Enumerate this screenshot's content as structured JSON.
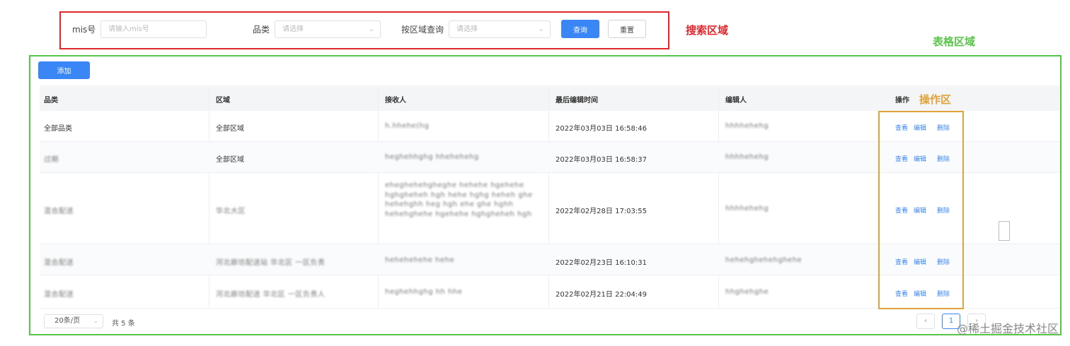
{
  "search": {
    "mis_label": "mis号",
    "mis_placeholder": "请输入mis号",
    "category_label": "品类",
    "category_placeholder": "请选择",
    "region_label": "按区域查询",
    "region_placeholder": "请选择",
    "query_button": "查询",
    "reset_button": "重置"
  },
  "annotations": {
    "search_area": "搜索区域",
    "table_area": "表格区域",
    "operation_area": "操作区"
  },
  "colors": {
    "primary": "#3a86f7",
    "search_box": "#e0262b",
    "table_box": "#56c548",
    "op_box": "#e0a33a"
  },
  "table": {
    "add_button": "添加",
    "headers": [
      "品类",
      "区域",
      "接收人",
      "最后编辑时间",
      "编辑人",
      "操作"
    ],
    "rows": [
      {
        "category": "全部品类",
        "region": "全部区域",
        "receiver": "h.hhehe(hg",
        "time": "2022年03月03日 16:58:46",
        "editor": "hhhhehehg"
      },
      {
        "category": "过期",
        "region": "全部区域",
        "receiver": "heghehhghg hhehehehg",
        "time": "2022年03月03日 16:58:37",
        "editor": "hhhhehehg"
      },
      {
        "category": "混合配送",
        "region": "华北大区",
        "receiver": "eheghehehgheghe hehehe hgehehe hghgheheh hgh hehe hghg heheh ghe hehehghh heg hgh ehe ghe hghh hehehghehe hgehehe hghgheheh hgh",
        "time": "2022年02月28日 17:03:55",
        "editor": "hhhhehehg"
      },
      {
        "category": "混合配送",
        "region": "河北廊坊配送站 华北区 一区负责",
        "receiver": "hehehehehe hehe",
        "time": "2022年02月23日 16:10:31",
        "editor": "hehehghehehghehe"
      },
      {
        "category": "混合配送",
        "region": "河北廊坊配送 华北区 一区负责人",
        "receiver": "heghehhghg hh hhe",
        "time": "2022年02月21日 22:04:49",
        "editor": "hhghehghe"
      }
    ],
    "actions": {
      "view": "查看",
      "edit": "编辑",
      "delete": "删除"
    }
  },
  "pagination": {
    "page_size": "20条/页",
    "total": "共 5 条",
    "prev": "‹",
    "page": "1",
    "next": "›"
  },
  "watermark": "@稀土掘金技术社区"
}
